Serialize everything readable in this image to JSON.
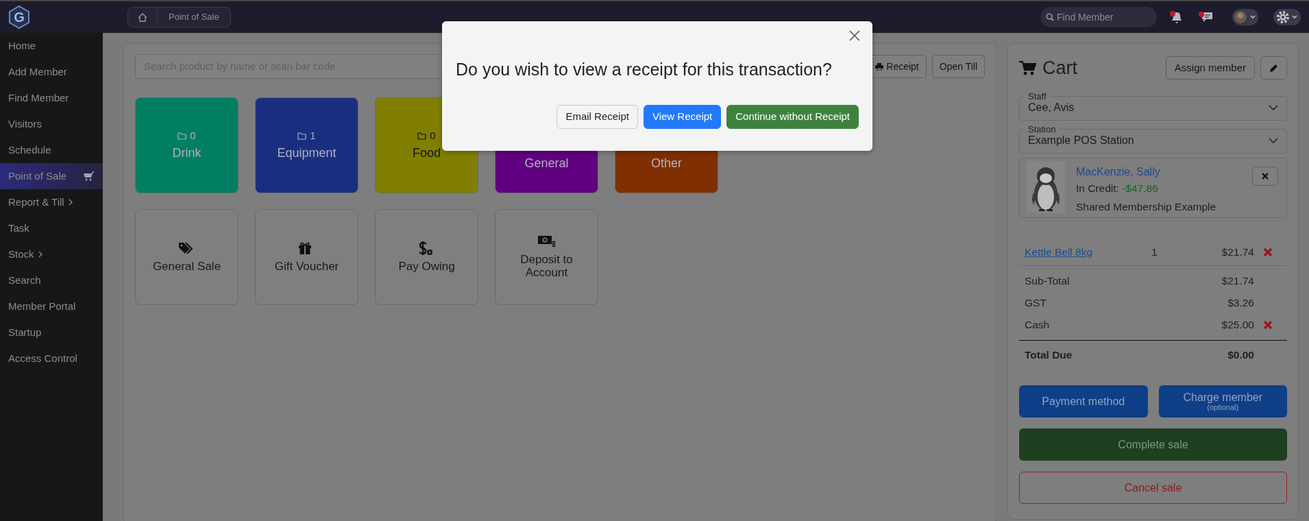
{
  "top_bar": {
    "logo": {
      "letter": "G"
    },
    "breadcrumb": [
      {
        "label": "Point of Sale"
      }
    ],
    "search": {
      "placeholder": "Find Member"
    },
    "bell": {
      "has_new": true
    },
    "chat": {
      "has_new": true
    }
  },
  "sidebar": {
    "items": [
      {
        "label": "Home",
        "selected": false,
        "expandable": false
      },
      {
        "label": "Add Member",
        "selected": false,
        "expandable": false
      },
      {
        "label": "Find Member",
        "selected": false,
        "expandable": false
      },
      {
        "label": "Visitors",
        "selected": false,
        "expandable": false
      },
      {
        "label": "Schedule",
        "selected": false,
        "expandable": false
      },
      {
        "label": "Point of Sale",
        "selected": true,
        "expandable": false
      },
      {
        "label": "Report & Till",
        "selected": false,
        "expandable": true
      },
      {
        "label": "Task",
        "selected": false,
        "expandable": false
      },
      {
        "label": "Stock",
        "selected": false,
        "expandable": true
      },
      {
        "label": "Search",
        "selected": false,
        "expandable": false
      },
      {
        "label": "Member Portal",
        "selected": false,
        "expandable": false
      },
      {
        "label": "Startup",
        "selected": false,
        "expandable": false
      },
      {
        "label": "Access Control",
        "selected": false,
        "expandable": false
      }
    ]
  },
  "product_search": {
    "placeholder": "Search product by name or scan bar code"
  },
  "toolbar": [
    {
      "label": "Receipt",
      "kind": "print"
    },
    {
      "label": "Open Till",
      "kind": "plain"
    }
  ],
  "categories": [
    {
      "name": "Drink",
      "count": "0",
      "color": "#007f62"
    },
    {
      "name": "Equipment",
      "count": "1",
      "color": "#1a2e80"
    },
    {
      "name": "Food",
      "count": "0",
      "color": "#807f00"
    },
    {
      "name": "General",
      "color": "#600080"
    },
    {
      "name": "Other",
      "color": "#803000"
    }
  ],
  "actions": [
    {
      "label": "General Sale",
      "kind": "tag"
    },
    {
      "label": "Gift Voucher",
      "kind": "gift"
    },
    {
      "label": "Pay Owing",
      "kind": "dollar"
    },
    {
      "label": "Deposit to Account",
      "kind": "cash"
    }
  ],
  "cart": {
    "title": "Cart",
    "assign_button": "Assign member",
    "staff": {
      "label": "Staff",
      "value": "Cee, Avis"
    },
    "station": {
      "label": "Station",
      "value": "Example POS Station"
    },
    "member": {
      "name": "MacKenzie, Sally",
      "credit_label": "In Credit:",
      "credit_value": "-$47.86",
      "note": "Shared Membership Example"
    },
    "lines": [
      {
        "name": "Kettle Bell 8kg",
        "qty": "1",
        "price": "$21.74",
        "removable": true
      }
    ],
    "summary": [
      {
        "label": "Sub-Total",
        "value": "$21.74",
        "kind": "line",
        "removable": false
      },
      {
        "label": "GST",
        "value": "$3.26",
        "kind": "line",
        "removable": false
      },
      {
        "label": "Cash",
        "value": "$25.00",
        "kind": "payment",
        "removable": true
      },
      {
        "label": "Total Due",
        "value": "$0.00",
        "kind": "total",
        "removable": false
      }
    ],
    "payment_button": "Payment method",
    "charge_button": {
      "label": "Charge member",
      "note": "(optional)"
    },
    "complete_button": "Complete sale",
    "cancel_button": "Cancel sale"
  },
  "modal": {
    "title": "Do you wish to view a receipt for this transaction?",
    "buttons": [
      {
        "label": "Email Receipt",
        "kind": "light"
      },
      {
        "label": "View Receipt",
        "kind": "primary"
      },
      {
        "label": "Continue without Receipt",
        "kind": "success"
      }
    ]
  }
}
